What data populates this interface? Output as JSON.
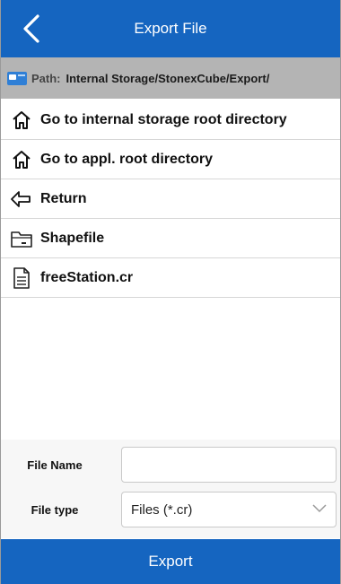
{
  "header": {
    "title": "Export File",
    "back_icon": "chevron-left-icon"
  },
  "path_bar": {
    "icon": "folder-card-icon",
    "prefix": "Path:",
    "value": "Internal Storage/StonexCube/Export/"
  },
  "list": [
    {
      "icon": "home-icon",
      "label": "Go to internal storage root directory"
    },
    {
      "icon": "home-icon",
      "label": "Go to appl. root directory"
    },
    {
      "icon": "return-arrow-icon",
      "label": "Return"
    },
    {
      "icon": "folder-icon",
      "label": "Shapefile"
    },
    {
      "icon": "document-icon",
      "label": "freeStation.cr"
    }
  ],
  "form": {
    "file_name_label": "File Name",
    "file_name_value": "",
    "file_type_label": "File type",
    "file_type_value": "Files (*.cr)"
  },
  "footer": {
    "export_label": "Export"
  },
  "colors": {
    "primary": "#1565c0",
    "path_bar": "#b4b4b4"
  }
}
